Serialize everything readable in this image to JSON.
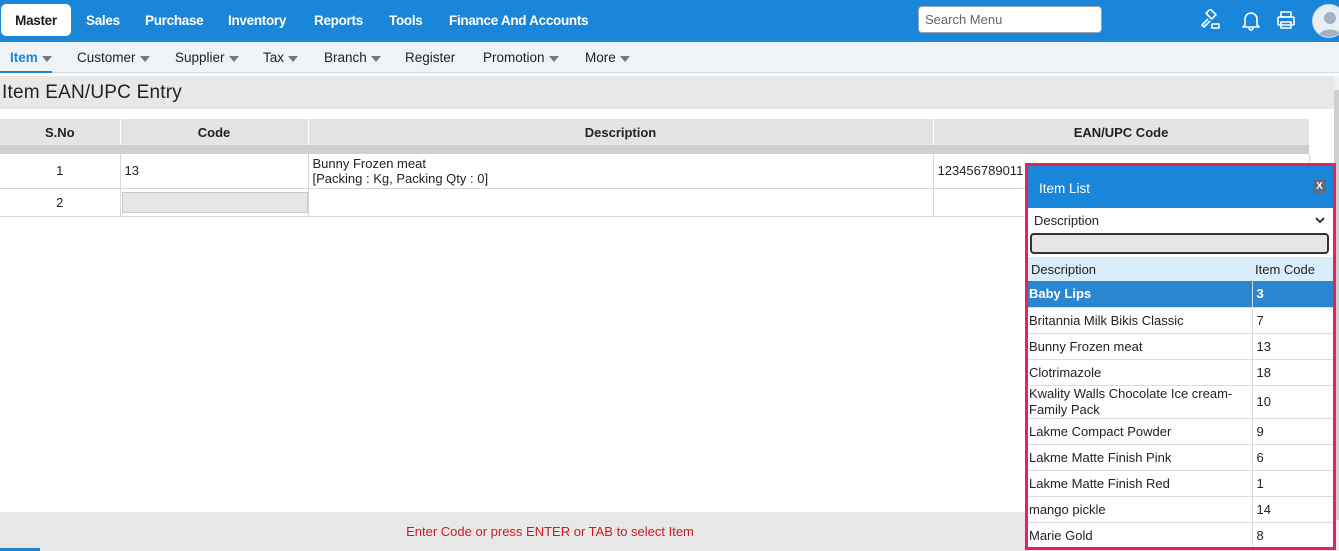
{
  "topnav": {
    "items": [
      "Master",
      "Sales",
      "Purchase",
      "Inventory",
      "Reports",
      "Tools",
      "Finance And Accounts"
    ]
  },
  "search": {
    "placeholder": "Search Menu"
  },
  "toolbar_icons": [
    "hammer-icon",
    "bell-icon",
    "printer-icon",
    "user-avatar"
  ],
  "subnav": {
    "items": [
      "Item",
      "Customer",
      "Supplier",
      "Tax",
      "Branch",
      "Register",
      "Promotion",
      "More"
    ]
  },
  "page": {
    "title": "Item EAN/UPC Entry"
  },
  "grid": {
    "headers": [
      "S.No",
      "Code",
      "Description",
      "EAN/UPC Code"
    ],
    "rows": [
      {
        "sno": "1",
        "code": "13",
        "description": "Bunny Frozen meat",
        "packing": "[Packing : Kg, Packing Qty : 0]",
        "ean": "123456789011"
      },
      {
        "sno": "2",
        "code": "",
        "description": "",
        "packing": "",
        "ean": ""
      }
    ]
  },
  "footer": {
    "hint": "Enter Code or press ENTER or TAB to select Item"
  },
  "popup": {
    "title": "Item List",
    "close": "X",
    "filter_selected": "Description",
    "headers": [
      "Description",
      "Item Code"
    ],
    "items": [
      {
        "desc": "Baby Lips",
        "code": "3"
      },
      {
        "desc": "Britannia Milk Bikis Classic",
        "code": "7"
      },
      {
        "desc": "Bunny Frozen meat",
        "code": "13"
      },
      {
        "desc": "Clotrimazole",
        "code": "18"
      },
      {
        "desc": "Kwality Walls Chocolate Ice cream-Family Pack",
        "code": "10"
      },
      {
        "desc": "Lakme Compact Powder",
        "code": "9"
      },
      {
        "desc": "Lakme Matte Finish Pink",
        "code": "6"
      },
      {
        "desc": "Lakme Matte Finish Red",
        "code": "1"
      },
      {
        "desc": "mango pickle",
        "code": "14"
      },
      {
        "desc": "Marie Gold",
        "code": "8"
      }
    ]
  },
  "colors": {
    "primary": "#1a86d9",
    "alert": "#d0181e",
    "popup_border": "#e8215a",
    "selected_row": "#2a86d1"
  }
}
